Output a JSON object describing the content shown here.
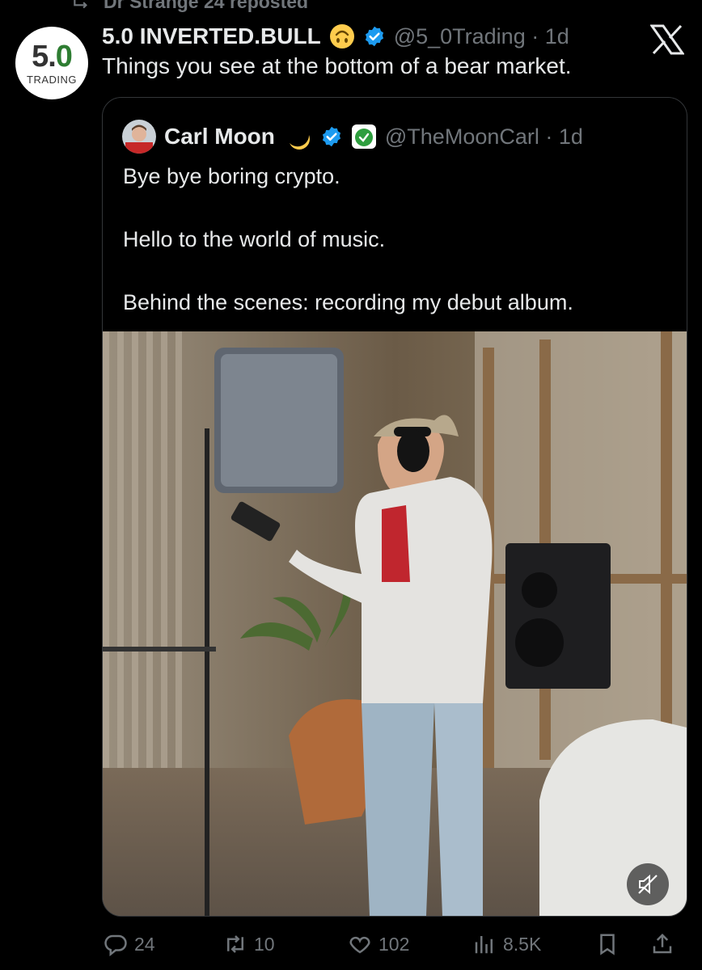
{
  "repost": {
    "text": "Dr Strange 24 reposted"
  },
  "tweet": {
    "avatar": {
      "big_a": "5.",
      "big_b": "0",
      "small": "TRADING"
    },
    "author_name": "5.0 INVERTED.BULL",
    "handle": "@5_0Trading",
    "time": "1d",
    "text": "Things you see at the bottom of a bear market."
  },
  "quote": {
    "author_name": "Carl Moon",
    "handle": "@TheMoonCarl",
    "time": "1d",
    "paragraphs": [
      "Bye bye boring crypto.",
      "Hello to the world of music.",
      "Behind the scenes: recording my debut album."
    ]
  },
  "actions": {
    "replies": "24",
    "reposts": "10",
    "likes": "102",
    "views": "8.5K"
  },
  "colors": {
    "background": "#000000",
    "text": "#e7e9ea",
    "muted": "#71767b",
    "verified": "#1d9bf0"
  }
}
